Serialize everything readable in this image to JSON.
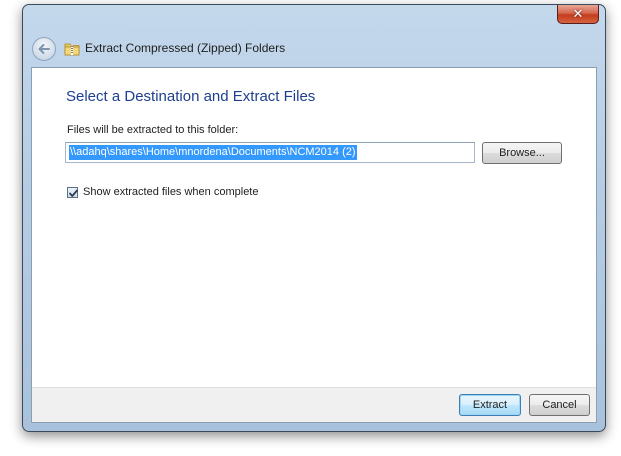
{
  "window": {
    "title": "Extract Compressed (Zipped) Folders",
    "close_glyph": "✕"
  },
  "icons": {
    "back": "back-arrow-icon",
    "folder": "zipped-folder-icon",
    "check": "checkmark-icon"
  },
  "main": {
    "heading": "Select a Destination and Extract Files",
    "path_label": "Files will be extracted to this folder:",
    "path_value": "\\\\adahq\\shares\\Home\\mnordena\\Documents\\NCM2014 (2)",
    "browse_label": "Browse...",
    "checkbox_label": "Show extracted files when complete",
    "checkbox_checked": true
  },
  "footer": {
    "extract_label": "Extract",
    "cancel_label": "Cancel"
  },
  "colors": {
    "heading": "#1e3f8e",
    "selection": "#3399ff",
    "close": "#c43b1d"
  }
}
